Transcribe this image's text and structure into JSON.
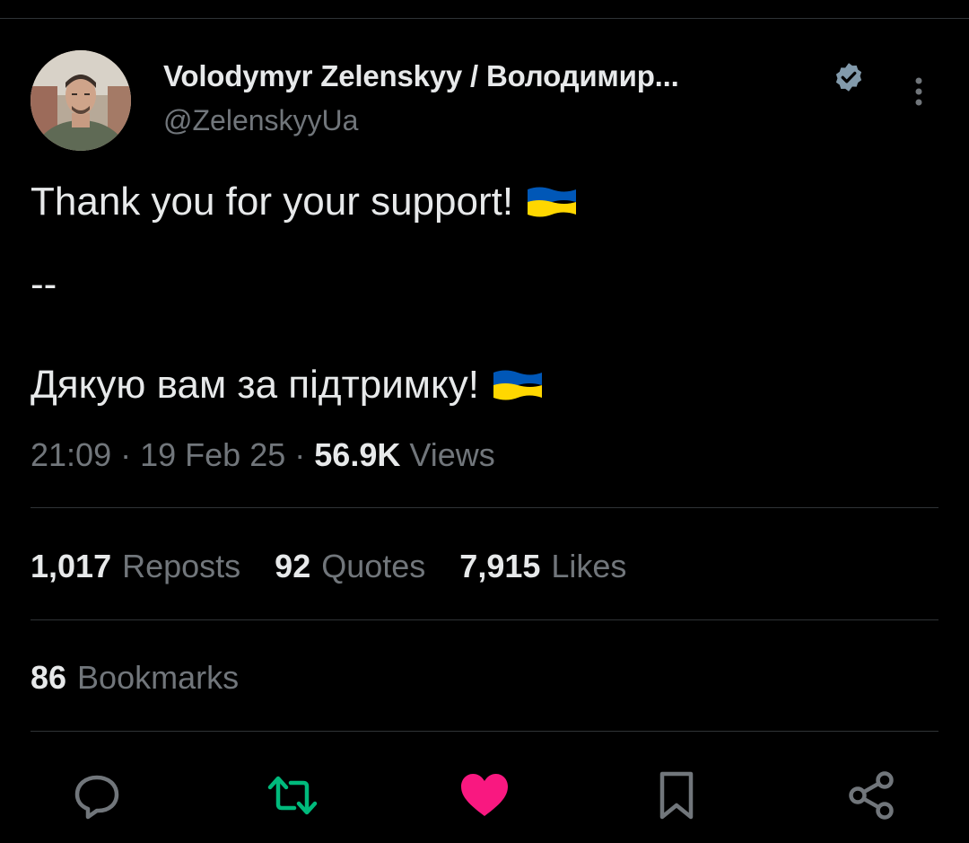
{
  "author": {
    "name": "Volodymyr Zelenskyy / Володимир...",
    "handle": "@ZelenskyyUa",
    "verified": true
  },
  "tweet": {
    "line1": "Thank you for your support!",
    "separator": "--",
    "line2": "Дякую вам за підтримку!",
    "emoji": "ukraine-flag"
  },
  "meta": {
    "time": "21:09",
    "date": "19 Feb 25",
    "views_count": "56.9K",
    "views_label": "Views",
    "dot": "·"
  },
  "stats": {
    "reposts_count": "1,017",
    "reposts_label": "Reposts",
    "quotes_count": "92",
    "quotes_label": "Quotes",
    "likes_count": "7,915",
    "likes_label": "Likes",
    "bookmarks_count": "86",
    "bookmarks_label": "Bookmarks"
  },
  "actions": [
    {
      "icon": "reply-icon"
    },
    {
      "icon": "repost-icon",
      "color": "#00ba7c"
    },
    {
      "icon": "like-icon",
      "color": "#f91880"
    },
    {
      "icon": "bookmark-icon"
    },
    {
      "icon": "share-icon"
    }
  ],
  "colors": {
    "background": "#000000",
    "text": "#e7e9ea",
    "muted": "#71767b",
    "verified": "#829aab",
    "repost": "#00ba7c",
    "like": "#f91880",
    "flag_blue": "#0057b7",
    "flag_yellow": "#ffd700"
  }
}
